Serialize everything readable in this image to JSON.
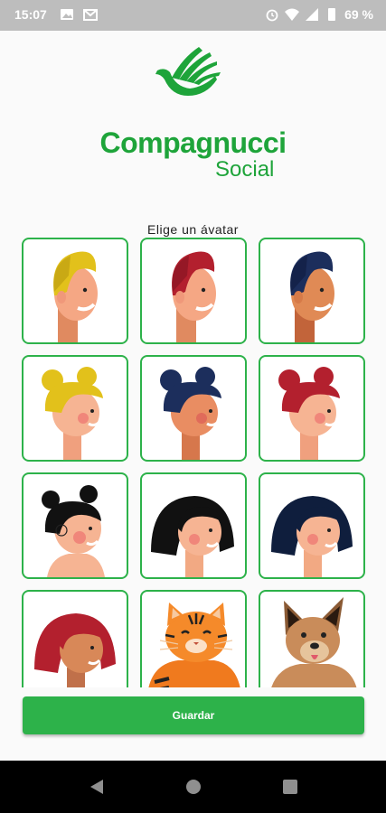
{
  "status_bar": {
    "time": "15:07",
    "battery": "69 %",
    "left_icons": [
      "image-icon",
      "gmail-icon"
    ],
    "right_icons": [
      "alarm-icon",
      "wifi-icon",
      "signal-icon",
      "battery-icon"
    ]
  },
  "brand": {
    "name": "Compagnucci",
    "subtitle": "Social",
    "color": "#1ea43a"
  },
  "prompt": "Elige un ávatar",
  "avatars": [
    {
      "id": "boy-yellow-hair"
    },
    {
      "id": "boy-red-hair"
    },
    {
      "id": "boy-navy-hair"
    },
    {
      "id": "girl-yellow-buns"
    },
    {
      "id": "girl-navy-buns"
    },
    {
      "id": "girl-red-buns"
    },
    {
      "id": "girl-black-buns"
    },
    {
      "id": "girl-black-bob"
    },
    {
      "id": "girl-navy-bob"
    },
    {
      "id": "girl-red-bob"
    },
    {
      "id": "tiger-cat"
    },
    {
      "id": "brown-dog"
    }
  ],
  "save_button": {
    "label": "Guardar",
    "color": "#2db24a"
  },
  "nav_bar": {
    "buttons": [
      "back-icon",
      "home-icon",
      "recents-icon"
    ]
  }
}
